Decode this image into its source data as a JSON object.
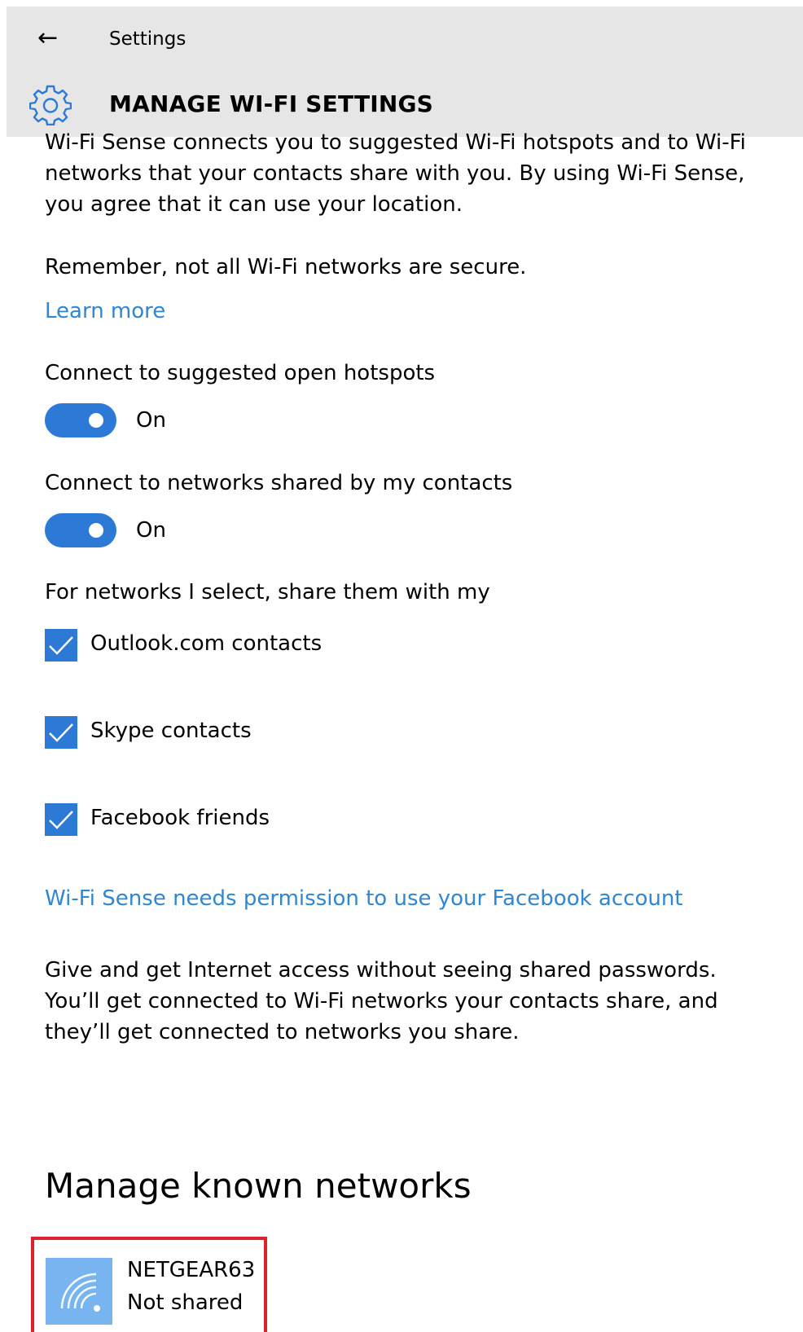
{
  "header": {
    "back_glyph": "←",
    "app_title": "Settings",
    "page_title": "MANAGE WI-FI SETTINGS"
  },
  "intro": {
    "lines": [
      "Wi-Fi Sense connects you to suggested Wi-Fi hotspots and to Wi-Fi",
      "networks that your contacts share with you. By using Wi-Fi Sense,",
      "you agree that it can use your location."
    ],
    "warning": "Remember, not all Wi-Fi networks are secure.",
    "learn_more": "Learn more"
  },
  "toggles": [
    {
      "label": "Connect to suggested open hotspots",
      "state": "On",
      "on": true
    },
    {
      "label": "Connect to networks shared by my contacts",
      "state": "On",
      "on": true
    }
  ],
  "share": {
    "heading": "For networks I select, share them with my",
    "options": [
      {
        "label": "Outlook.com contacts",
        "checked": true
      },
      {
        "label": "Skype contacts",
        "checked": true
      },
      {
        "label": "Facebook friends",
        "checked": true
      }
    ],
    "facebook_link": "Wi-Fi Sense needs permission to use your Facebook account"
  },
  "info": {
    "lines": [
      "Give and get Internet access without seeing shared passwords.",
      "You’ll get connected to Wi-Fi networks your contacts share, and",
      "they’ll get connected to networks you share."
    ]
  },
  "known_networks": {
    "heading": "Manage known networks",
    "items": [
      {
        "name": "NETGEAR63",
        "status": "Not shared",
        "icon": "wifi-icon"
      }
    ]
  },
  "colors": {
    "accent": "#2d7ad6",
    "link": "#2f86d1",
    "header_bg": "#e6e6e6",
    "network_tile": "#78b4f0",
    "highlight_border": "#e0202a"
  }
}
